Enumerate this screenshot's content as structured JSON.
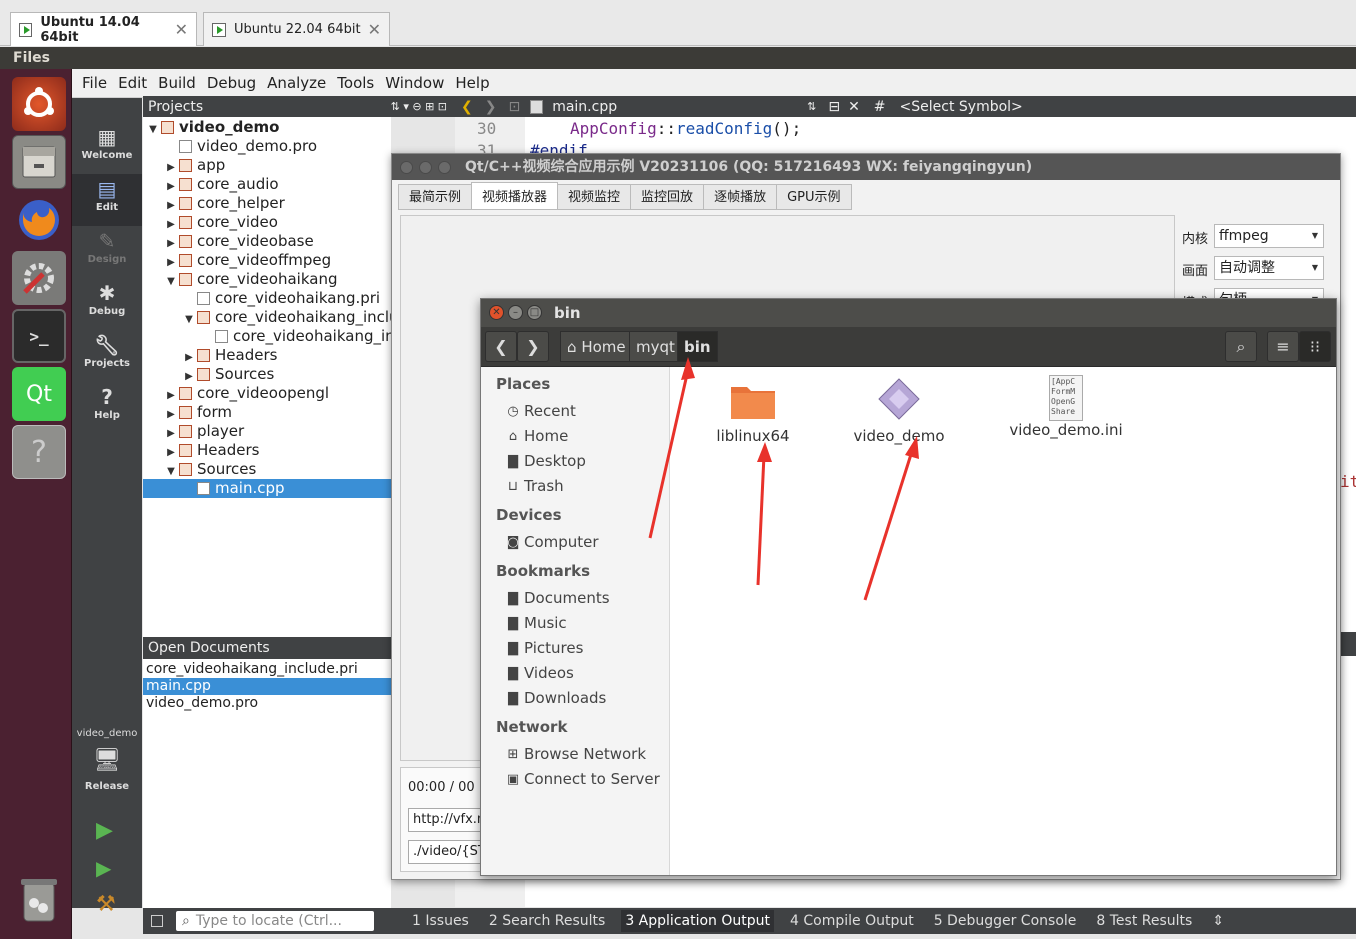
{
  "vm_tabs": [
    {
      "label": "Ubuntu 14.04 64bit",
      "close": "✕",
      "active": true
    },
    {
      "label": "Ubuntu 22.04 64bit",
      "close": "✕",
      "active": false
    }
  ],
  "top_panel": {
    "title": "Files"
  },
  "launcher": {
    "items": [
      "ubuntu-logo-icon",
      "files-icon",
      "firefox-icon",
      "settings-icon",
      "terminal-icon",
      "qt-creator-icon",
      "help-icon",
      "trash-icon"
    ],
    "qt_label": "Qt",
    "help_label": "?"
  },
  "menu": [
    "File",
    "Edit",
    "Build",
    "Debug",
    "Analyze",
    "Tools",
    "Window",
    "Help"
  ],
  "modes": [
    {
      "label": "Welcome",
      "icon": "welcome-icon"
    },
    {
      "label": "Edit",
      "icon": "edit-icon"
    },
    {
      "label": "Design",
      "icon": "design-icon"
    },
    {
      "label": "Debug",
      "icon": "debug-icon"
    },
    {
      "label": "Projects",
      "icon": "projects-icon"
    },
    {
      "label": "Help",
      "icon": "help-icon"
    }
  ],
  "kit": {
    "project": "video_demo",
    "config": "Release"
  },
  "projects": {
    "header": "Projects",
    "tree": [
      {
        "label": "video_demo",
        "depth": 0,
        "arrow": "▼",
        "bold": true
      },
      {
        "label": "video_demo.pro",
        "depth": 1,
        "arrow": ""
      },
      {
        "label": "app",
        "depth": 1,
        "arrow": "▶"
      },
      {
        "label": "core_audio",
        "depth": 1,
        "arrow": "▶"
      },
      {
        "label": "core_helper",
        "depth": 1,
        "arrow": "▶"
      },
      {
        "label": "core_video",
        "depth": 1,
        "arrow": "▶"
      },
      {
        "label": "core_videobase",
        "depth": 1,
        "arrow": "▶"
      },
      {
        "label": "core_videoffmpeg",
        "depth": 1,
        "arrow": "▶"
      },
      {
        "label": "core_videohaikang",
        "depth": 1,
        "arrow": "▼"
      },
      {
        "label": "core_videohaikang.pri",
        "depth": 2,
        "arrow": ""
      },
      {
        "label": "core_videohaikang_include",
        "depth": 2,
        "arrow": "▼"
      },
      {
        "label": "core_videohaikang_include.pri",
        "depth": 3,
        "arrow": ""
      },
      {
        "label": "Headers",
        "depth": 2,
        "arrow": "▶"
      },
      {
        "label": "Sources",
        "depth": 2,
        "arrow": "▶"
      },
      {
        "label": "core_videoopengl",
        "depth": 1,
        "arrow": "▶"
      },
      {
        "label": "form",
        "depth": 1,
        "arrow": "▶"
      },
      {
        "label": "player",
        "depth": 1,
        "arrow": "▶"
      },
      {
        "label": "Headers",
        "depth": 1,
        "arrow": "▶"
      },
      {
        "label": "Sources",
        "depth": 1,
        "arrow": "▼"
      },
      {
        "label": "main.cpp",
        "depth": 2,
        "arrow": "",
        "selected": true
      }
    ]
  },
  "open_documents": {
    "header": "Open Documents",
    "items": [
      "core_videohaikang_include.pri",
      "main.cpp",
      "video_demo.pro"
    ],
    "selected": 1
  },
  "editor": {
    "file": "main.cpp",
    "symbol": "<Select Symbol>",
    "hash": "#",
    "line_numbers": [
      "30",
      "31"
    ],
    "code_line_scope": "AppConfig",
    "code_line_sep": "::",
    "code_line_call": "readConfig",
    "code_line_end": "();",
    "code_line2": "#endif",
    "right_fragment": "it"
  },
  "output_pane": {
    "locate_placeholder": "Type to locate (Ctrl...",
    "tabs": [
      "1  Issues",
      "2  Search Results",
      "3  Application Output",
      "4  Compile Output",
      "5  Debugger Console",
      "8  Test Results"
    ],
    "active": 2
  },
  "qt_demo": {
    "title": "Qt/C++视频综合应用示例 V20231106 (QQ: 517216493 WX: feiyangqingyun)",
    "tabs": [
      "最简示例",
      "视频播放器",
      "视频监控",
      "监控回放",
      "逐帧播放",
      "GPU示例"
    ],
    "active_tab": 1,
    "core_label": "内核",
    "core_value": "ffmpeg",
    "picture_label": "画面",
    "picture_value": "自动调整",
    "mode_label": "模式",
    "mode_value": "句柄",
    "time": "00:00  /  00",
    "url1": "http://vfx.m",
    "url2": "./video/{ST"
  },
  "nautilus": {
    "title": "bin",
    "breadcrumbs": [
      "Home",
      "myqt",
      "bin"
    ],
    "places_header": "Places",
    "places": [
      {
        "label": "Recent",
        "icon": "clock-icon"
      },
      {
        "label": "Home",
        "icon": "home-icon"
      },
      {
        "label": "Desktop",
        "icon": "folder-icon"
      },
      {
        "label": "Trash",
        "icon": "trash-icon"
      }
    ],
    "devices_header": "Devices",
    "devices": [
      {
        "label": "Computer",
        "icon": "drive-icon"
      }
    ],
    "bookmarks_header": "Bookmarks",
    "bookmarks": [
      {
        "label": "Documents",
        "icon": "folder-icon"
      },
      {
        "label": "Music",
        "icon": "folder-icon"
      },
      {
        "label": "Pictures",
        "icon": "folder-icon"
      },
      {
        "label": "Videos",
        "icon": "folder-icon"
      },
      {
        "label": "Downloads",
        "icon": "folder-icon"
      }
    ],
    "network_header": "Network",
    "network": [
      {
        "label": "Browse Network",
        "icon": "network-icon"
      },
      {
        "label": "Connect to Server",
        "icon": "server-icon"
      }
    ],
    "files": [
      {
        "label": "liblinux64",
        "icon": "folder-icon"
      },
      {
        "label": "video_demo",
        "icon": "executable-icon"
      },
      {
        "label": "video_demo.ini",
        "icon": "text-file-icon"
      }
    ],
    "ini_preview": [
      "[AppC",
      "FormM",
      "OpenG",
      "Share"
    ]
  },
  "colors": {
    "accent": "#3a8fd6",
    "annotation": "#e8322b",
    "launcher": "#4b2131"
  }
}
